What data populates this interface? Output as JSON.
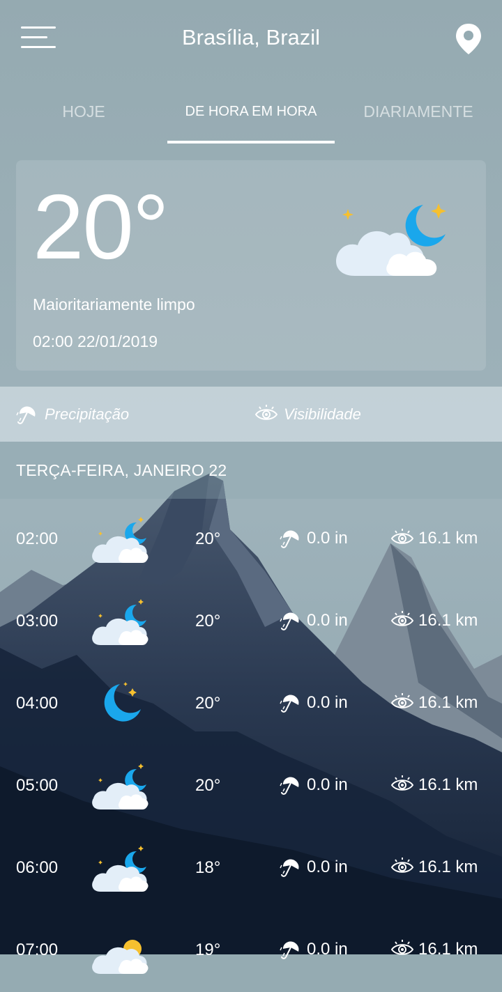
{
  "header": {
    "city": "Brasília, Brazil",
    "menu_icon": "hamburger-menu-icon",
    "location_icon": "location-pin-icon"
  },
  "tabs": [
    {
      "label": "HOJE",
      "active": false
    },
    {
      "label": "DE HORA EM HORA",
      "active": true
    },
    {
      "label": "DIARIAMENTE",
      "active": false
    }
  ],
  "current": {
    "temperature": "20°",
    "condition": "Maioritariamente limpo",
    "datetime": "02:00 22/01/2019",
    "icon": "partly-cloudy-night-icon"
  },
  "legend": {
    "precipitation": "Precipitação",
    "visibility": "Visibilidade"
  },
  "day_header": "TERÇA-FEIRA, JANEIRO 22",
  "hours": [
    {
      "time": "02:00",
      "icon": "partly-cloudy-night-icon",
      "temp": "20°",
      "precip": "0.0 in",
      "visibility": "16.1 km"
    },
    {
      "time": "03:00",
      "icon": "partly-cloudy-night-icon",
      "temp": "20°",
      "precip": "0.0 in",
      "visibility": "16.1 km"
    },
    {
      "time": "04:00",
      "icon": "clear-night-icon",
      "temp": "20°",
      "precip": "0.0 in",
      "visibility": "16.1 km"
    },
    {
      "time": "05:00",
      "icon": "partly-cloudy-night-icon",
      "temp": "20°",
      "precip": "0.0 in",
      "visibility": "16.1 km"
    },
    {
      "time": "06:00",
      "icon": "partly-cloudy-night-icon",
      "temp": "18°",
      "precip": "0.0 in",
      "visibility": "16.1 km"
    },
    {
      "time": "07:00",
      "icon": "partly-cloudy-day-icon",
      "temp": "19°",
      "precip": "0.0 in",
      "visibility": "16.1 km"
    }
  ],
  "colors": {
    "moon": "#1aa7ec",
    "star": "#f6c02f",
    "sun": "#f6c02f",
    "cloud": "#e3eef8",
    "cloud_front": "#ffffff"
  }
}
